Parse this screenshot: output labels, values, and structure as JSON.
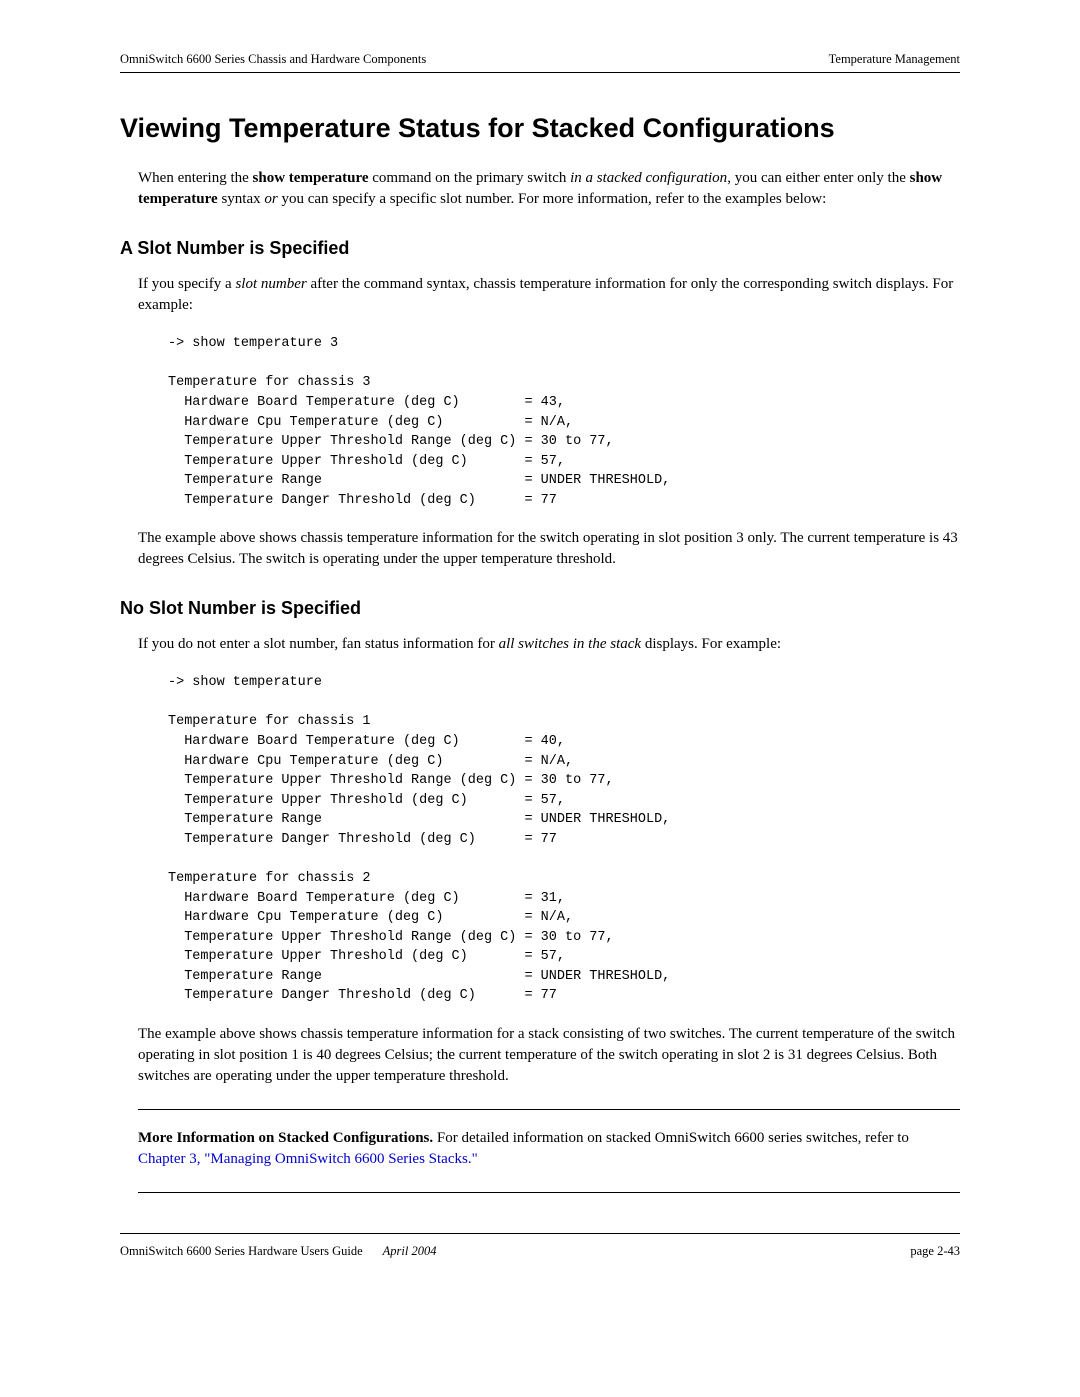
{
  "header": {
    "left": "OmniSwitch 6600 Series Chassis and Hardware Components",
    "right": "Temperature Management"
  },
  "title": "Viewing Temperature Status for Stacked Configurations",
  "intro": {
    "part1": "When entering the ",
    "bold1": "show temperature",
    "part2": " command on the primary switch ",
    "italic1": "in a stacked configuration",
    "part3": ", you can either enter only the ",
    "bold2": "show temperature",
    "part4": " syntax ",
    "italic2": "or",
    "part5": " you can specify a specific slot number. For more information, refer to the examples below:"
  },
  "section1": {
    "heading": "A Slot Number is Specified",
    "para_part1": "If you specify a ",
    "para_italic": "slot number",
    "para_part2": " after the command syntax, chassis temperature information for only the corresponding switch displays. For example:",
    "code": "-> show temperature 3\n\nTemperature for chassis 3\n  Hardware Board Temperature (deg C)        = 43,\n  Hardware Cpu Temperature (deg C)          = N/A,\n  Temperature Upper Threshold Range (deg C) = 30 to 77,\n  Temperature Upper Threshold (deg C)       = 57,\n  Temperature Range                         = UNDER THRESHOLD,\n  Temperature Danger Threshold (deg C)      = 77",
    "after": "The example above shows chassis temperature information for the switch operating in slot position 3 only. The current temperature is 43 degrees Celsius. The switch is operating under the upper temperature threshold."
  },
  "section2": {
    "heading": "No Slot Number is Specified",
    "para_part1": "If you do not enter a slot number, fan status information for ",
    "para_italic": "all switches in the stack",
    "para_part2": " displays. For example:",
    "code": "-> show temperature\n\nTemperature for chassis 1\n  Hardware Board Temperature (deg C)        = 40,\n  Hardware Cpu Temperature (deg C)          = N/A,\n  Temperature Upper Threshold Range (deg C) = 30 to 77,\n  Temperature Upper Threshold (deg C)       = 57,\n  Temperature Range                         = UNDER THRESHOLD,\n  Temperature Danger Threshold (deg C)      = 77\n\nTemperature for chassis 2\n  Hardware Board Temperature (deg C)        = 31,\n  Hardware Cpu Temperature (deg C)          = N/A,\n  Temperature Upper Threshold Range (deg C) = 30 to 77,\n  Temperature Upper Threshold (deg C)       = 57,\n  Temperature Range                         = UNDER THRESHOLD,\n  Temperature Danger Threshold (deg C)      = 77",
    "after": "The example above shows chassis temperature information for a stack consisting of two switches. The current temperature of the switch operating in slot position 1 is 40 degrees Celsius; the current temperature of the switch operating in slot 2 is 31 degrees Celsius. Both switches are operating under the upper temperature threshold."
  },
  "moreinfo": {
    "bold": "More Information on Stacked Configurations.",
    "text": " For detailed information on stacked OmniSwitch 6600 series switches, refer to ",
    "link": "Chapter 3, \"Managing OmniSwitch 6600 Series Stacks.\""
  },
  "footer": {
    "doc": "OmniSwitch 6600 Series Hardware Users Guide",
    "date": "April 2004",
    "page": "page 2-43"
  }
}
